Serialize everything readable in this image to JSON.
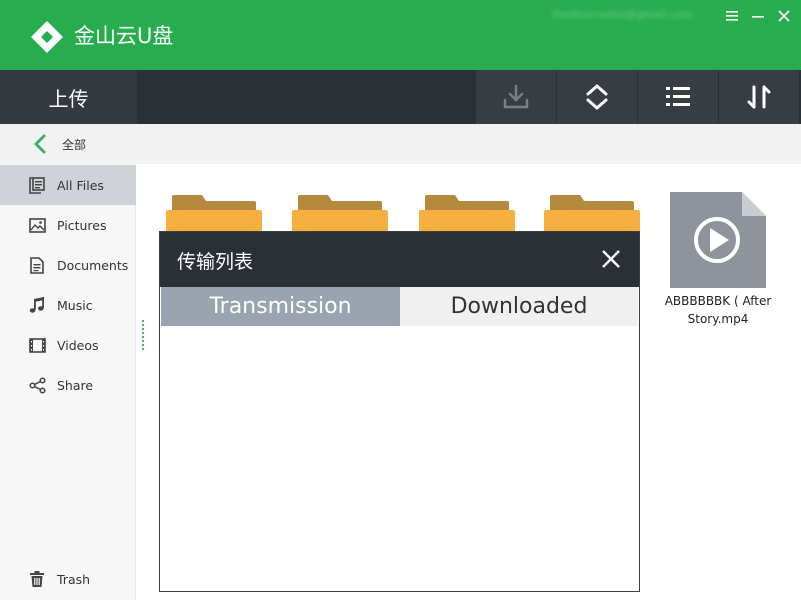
{
  "app": {
    "title": "金山云U盘",
    "user_account": "thedrocrasho@gmail.com"
  },
  "toolbar": {
    "upload_label": "上传",
    "buttons": [
      "download-icon",
      "sort-icon",
      "list-view-icon",
      "transfer-icon"
    ]
  },
  "breadcrumb": {
    "current": "全部"
  },
  "sidebar": {
    "items": [
      {
        "label": "All Files",
        "icon": "all-files-icon",
        "active": true
      },
      {
        "label": "Pictures",
        "icon": "pictures-icon",
        "active": false
      },
      {
        "label": "Documents",
        "icon": "documents-icon",
        "active": false
      },
      {
        "label": "Music",
        "icon": "music-icon",
        "active": false
      },
      {
        "label": "Videos",
        "icon": "videos-icon",
        "active": false
      },
      {
        "label": "Share",
        "icon": "share-icon",
        "active": false
      }
    ],
    "trash": {
      "label": "Trash",
      "icon": "trash-icon"
    }
  },
  "files": {
    "video_name_line1": "ABBBBBBK ( After",
    "video_name_line2": "Story.mp4"
  },
  "modal": {
    "title": "传输列表",
    "tabs": [
      {
        "label": "Transmission",
        "active": true
      },
      {
        "label": "Downloaded",
        "active": false
      }
    ]
  },
  "colors": {
    "brand_green": "#27ad4e",
    "toolbar_dark": "#2b2f36",
    "folder_tan": "#b58a3c",
    "folder_yellow": "#f7b040",
    "video_gray": "#8f939c"
  }
}
